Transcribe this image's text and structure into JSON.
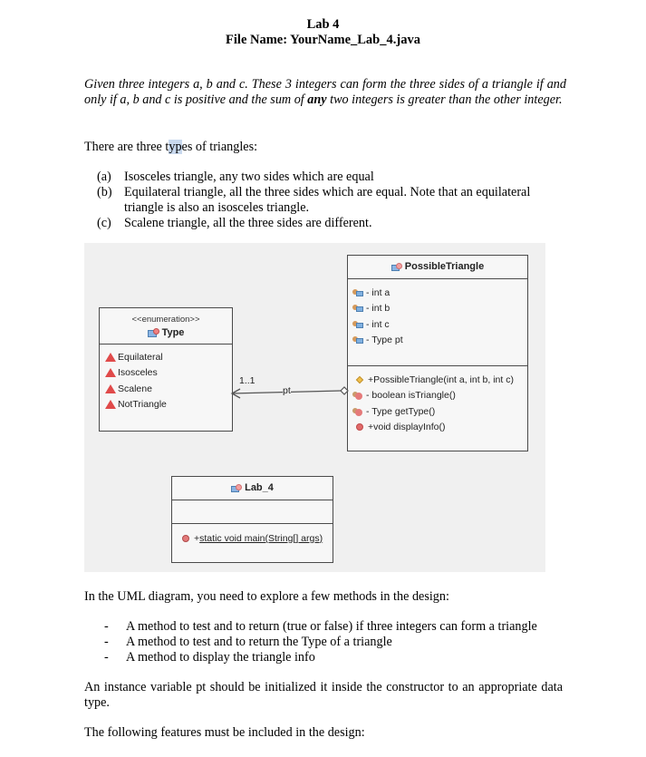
{
  "header": {
    "title": "Lab 4",
    "filename": "File Name: YourName_Lab_4.java"
  },
  "intro": {
    "part1": "Given three integers a, b and c. These 3 integers can form the three sides of a triangle if and only if a, b and c is positive and the sum of ",
    "emphasis": "any",
    "part2": " two integers is greater than the other integer."
  },
  "types_intro": {
    "before": "There are three t",
    "highlight": "yp",
    "after": "es of triangles:"
  },
  "types_list": [
    {
      "label": "(a)",
      "text": "Isosceles triangle, any two sides which are equal"
    },
    {
      "label": "(b)",
      "text": "Equilateral triangle, all the three sides which are equal. Note that an equilateral triangle is also an isosceles triangle."
    },
    {
      "label": "(c)",
      "text": "Scalene triangle, all the three sides are different."
    }
  ],
  "uml": {
    "possible_triangle": {
      "name": "PossibleTriangle",
      "fields": [
        "- int a",
        "- int b",
        "- int c",
        "- Type pt"
      ],
      "methods": [
        {
          "icon": "constructor",
          "text": "+PossibleTriangle(int a, int b, int c)"
        },
        {
          "icon": "private-method",
          "text": "- boolean isTriangle()"
        },
        {
          "icon": "private-method",
          "text": "- Type getType()"
        },
        {
          "icon": "public-method",
          "text": "+void displayInfo()"
        }
      ]
    },
    "type_enum": {
      "stereotype": "<<enumeration>>",
      "name": "Type",
      "literals": [
        "Equilateral",
        "Isosceles",
        "Scalene",
        "NotTriangle"
      ]
    },
    "lab4": {
      "name": "Lab_4",
      "method_prefix": "+ ",
      "method": "static void main(String[] args)"
    },
    "association": {
      "multiplicity": "1..1",
      "role": "pt"
    }
  },
  "methods_intro": "In the UML diagram, you need to explore a few methods in the design:",
  "methods_list": [
    "A method to test and to return (true or false) if three integers can form a triangle",
    "A method to test and to return the Type of a triangle",
    "A method to display the triangle info"
  ],
  "instance_note": "An instance variable pt should be initialized it inside the constructor to an appropriate data type.",
  "features_intro": "The following features must be included in the design:"
}
